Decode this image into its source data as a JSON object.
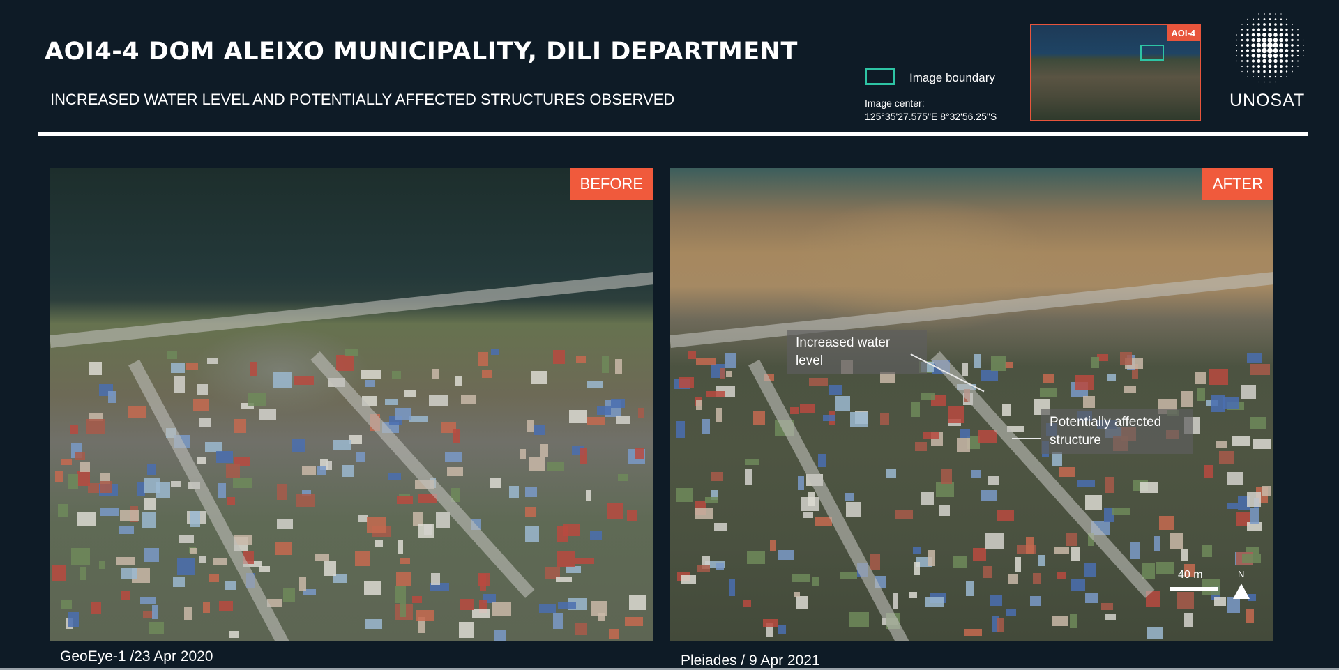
{
  "header": {
    "title": "AOI4-4 DOM ALEIXO MUNICIPALITY, DILI DEPARTMENT",
    "subtitle": "INCREASED WATER LEVEL AND POTENTIALLY AFFECTED STRUCTURES OBSERVED"
  },
  "legend": {
    "boundary_label": "Image boundary",
    "center_label": "Image center:",
    "center_value": "125°35'27.575\"E  8°32'56.25\"S",
    "boundary_color": "#2ec4a4"
  },
  "inset": {
    "tag": "AOI-4",
    "accent_color": "#e8553c"
  },
  "logo": {
    "text": "UNOSAT"
  },
  "panels": {
    "before": {
      "tag": "BEFORE",
      "source": "GeoEye-1 /23 Apr 2020"
    },
    "after": {
      "tag": "AFTER",
      "source": "Pleiades / 9 Apr 2021",
      "callouts": [
        {
          "text": "Increased water level"
        },
        {
          "text": "Potentially affected structure"
        }
      ],
      "scale_label": "40 m",
      "north_label": "N"
    }
  },
  "colors": {
    "background": "#0e1b26",
    "tag": "#f05a3c"
  }
}
